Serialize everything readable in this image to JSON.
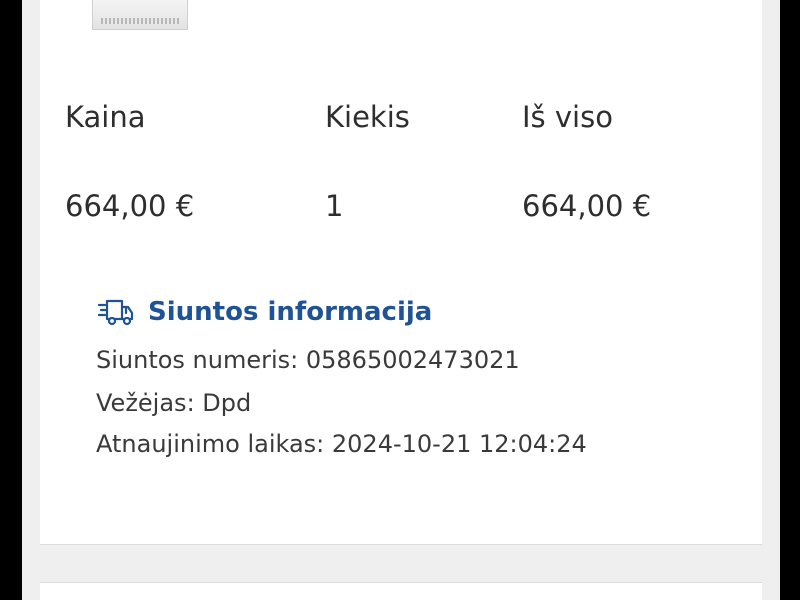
{
  "order_table": {
    "headers": {
      "price": "Kaina",
      "quantity": "Kiekis",
      "total": "Iš viso"
    },
    "row": {
      "price": "664,00 €",
      "quantity": "1",
      "total": "664,00 €"
    }
  },
  "shipment": {
    "icon": "delivery-truck-icon",
    "title": "Siuntos informacija",
    "tracking_line": "Siuntos numeris: 05865002473021",
    "carrier_line": "Vežėjas: Dpd",
    "updated_line": "Atnaujinimo laikas: 2024-10-21 12:04:24"
  },
  "colors": {
    "accent": "#1f5393",
    "text": "#2e2e2e",
    "card": "#ffffff",
    "page": "#efefef"
  }
}
